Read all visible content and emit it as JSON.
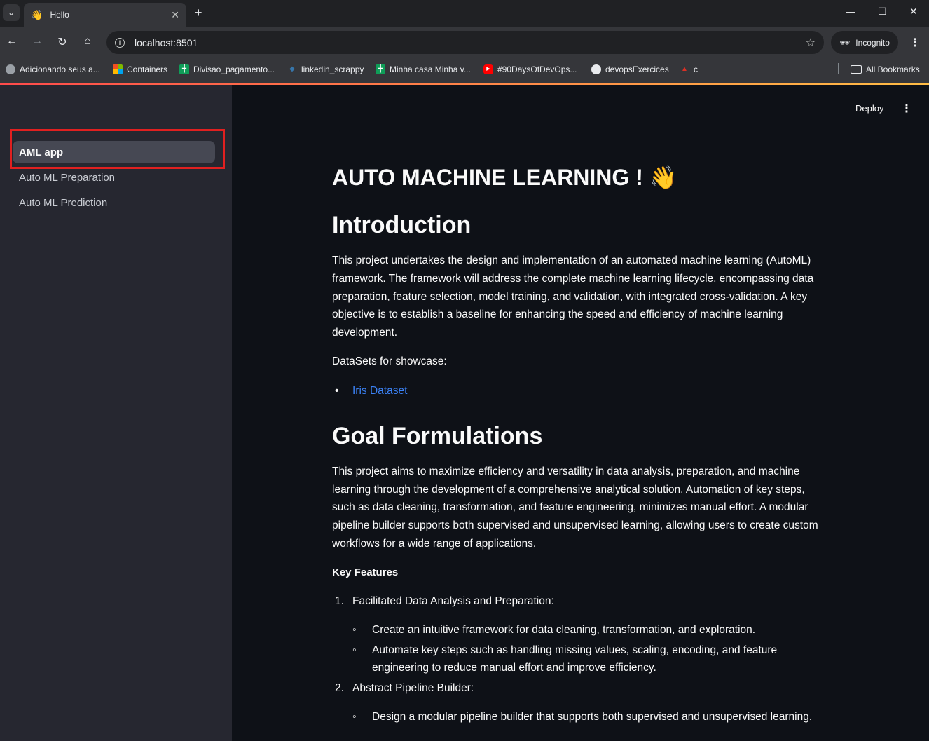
{
  "browser": {
    "tab_title": "Hello",
    "tab_favicon": "👋",
    "url": "localhost:8501",
    "incognito_label": "Incognito",
    "bookmarks": [
      {
        "label": "Adicionando seus a...",
        "icon": "web-icon",
        "color": "#9aa0a6"
      },
      {
        "label": "Containers",
        "icon": "microsoft-icon",
        "color": "#f25022"
      },
      {
        "label": "Divisao_pagamento...",
        "icon": "sheets-icon",
        "color": "#0f9d58"
      },
      {
        "label": "linkedin_scrappy",
        "icon": "python-icon",
        "color": "#3776ab"
      },
      {
        "label": "Minha casa Minha v...",
        "icon": "sheets-icon",
        "color": "#0f9d58"
      },
      {
        "label": "#90DaysOfDevOps...",
        "icon": "youtube-icon",
        "color": "#ff0000"
      },
      {
        "label": "devopsExercices",
        "icon": "github-icon",
        "color": "#e8eaed"
      },
      {
        "label": "c",
        "icon": "fire-icon",
        "color": "#d93025"
      }
    ],
    "all_bookmarks_label": "All Bookmarks"
  },
  "app": {
    "deploy_label": "Deploy",
    "sidebar": {
      "items": [
        {
          "label": "AML app",
          "active": true
        },
        {
          "label": "Auto ML Preparation",
          "active": false
        },
        {
          "label": "Auto ML Prediction",
          "active": false
        }
      ]
    },
    "content": {
      "title": "AUTO MACHINE LEARNING ! 👋",
      "intro_heading": "Introduction",
      "intro_text": "This project undertakes the design and implementation of an automated machine learning (AutoML) framework. The framework will address the complete machine learning lifecycle, encompassing data preparation, feature selection, model training, and validation, with integrated cross-validation. A key objective is to establish a baseline for enhancing the speed and efficiency of machine learning development.",
      "datasets_label": "DataSets for showcase:",
      "dataset_link": "Iris Dataset",
      "goal_heading": "Goal Formulations",
      "goal_text": "This project aims to maximize efficiency and versatility in data analysis, preparation, and machine learning through the development of a comprehensive analytical solution. Automation of key steps, such as data cleaning, transformation, and feature engineering, minimizes manual effort. A modular pipeline builder supports both supervised and unsupervised learning, allowing users to create custom workflows for a wide range of applications.",
      "key_features_label": "Key Features",
      "features": [
        {
          "num": "1.",
          "title": "Facilitated Data Analysis and Preparation:",
          "subs": [
            "Create an intuitive framework for data cleaning, transformation, and exploration.",
            "Automate key steps such as handling missing values, scaling, encoding, and feature engineering to reduce manual effort and improve efficiency."
          ]
        },
        {
          "num": "2.",
          "title": "Abstract Pipeline Builder:",
          "subs": [
            "Design a modular pipeline builder that supports both supervised and unsupervised learning."
          ]
        }
      ]
    }
  }
}
